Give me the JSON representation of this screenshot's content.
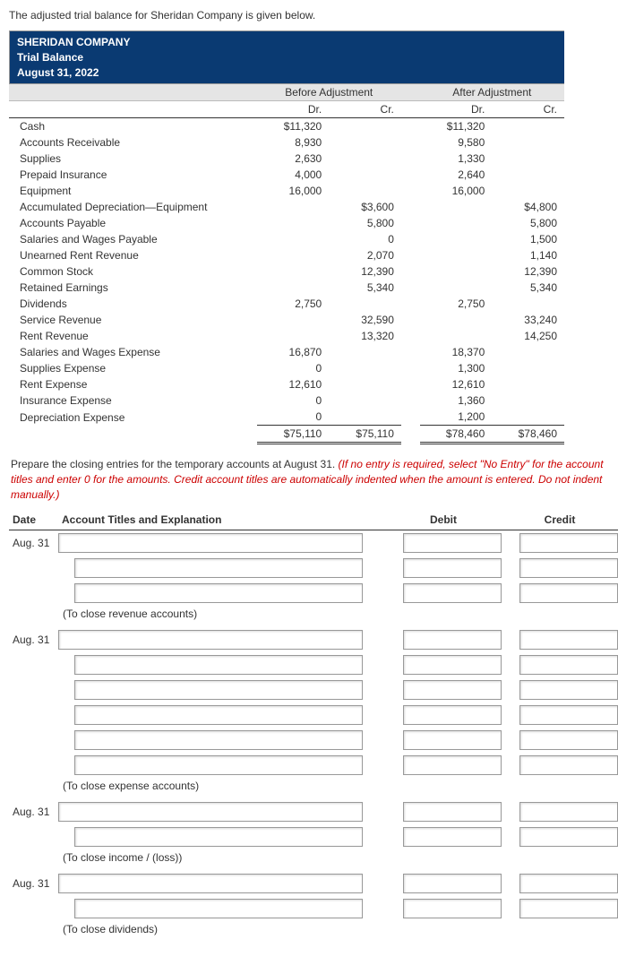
{
  "intro": "The adjusted trial balance for Sheridan Company is given below.",
  "company": "SHERIDAN COMPANY",
  "report": "Trial Balance",
  "asof": "August 31, 2022",
  "group_before": "Before Adjustment",
  "group_after": "After Adjustment",
  "col_dr": "Dr.",
  "col_cr": "Cr.",
  "rows": [
    {
      "a": "Cash",
      "bd": "$11,320",
      "bc": "",
      "ad": "$11,320",
      "ac": ""
    },
    {
      "a": "Accounts Receivable",
      "bd": "8,930",
      "bc": "",
      "ad": "9,580",
      "ac": ""
    },
    {
      "a": "Supplies",
      "bd": "2,630",
      "bc": "",
      "ad": "1,330",
      "ac": ""
    },
    {
      "a": "Prepaid Insurance",
      "bd": "4,000",
      "bc": "",
      "ad": "2,640",
      "ac": ""
    },
    {
      "a": "Equipment",
      "bd": "16,000",
      "bc": "",
      "ad": "16,000",
      "ac": ""
    },
    {
      "a": "Accumulated Depreciation—Equipment",
      "bd": "",
      "bc": "$3,600",
      "ad": "",
      "ac": "$4,800"
    },
    {
      "a": "Accounts Payable",
      "bd": "",
      "bc": "5,800",
      "ad": "",
      "ac": "5,800"
    },
    {
      "a": "Salaries and Wages Payable",
      "bd": "",
      "bc": "0",
      "ad": "",
      "ac": "1,500"
    },
    {
      "a": "Unearned Rent Revenue",
      "bd": "",
      "bc": "2,070",
      "ad": "",
      "ac": "1,140"
    },
    {
      "a": "Common Stock",
      "bd": "",
      "bc": "12,390",
      "ad": "",
      "ac": "12,390"
    },
    {
      "a": "Retained Earnings",
      "bd": "",
      "bc": "5,340",
      "ad": "",
      "ac": "5,340"
    },
    {
      "a": "Dividends",
      "bd": "2,750",
      "bc": "",
      "ad": "2,750",
      "ac": ""
    },
    {
      "a": "Service Revenue",
      "bd": "",
      "bc": "32,590",
      "ad": "",
      "ac": "33,240"
    },
    {
      "a": "Rent Revenue",
      "bd": "",
      "bc": "13,320",
      "ad": "",
      "ac": "14,250"
    },
    {
      "a": "Salaries and Wages Expense",
      "bd": "16,870",
      "bc": "",
      "ad": "18,370",
      "ac": ""
    },
    {
      "a": "Supplies Expense",
      "bd": "0",
      "bc": "",
      "ad": "1,300",
      "ac": ""
    },
    {
      "a": "Rent Expense",
      "bd": "12,610",
      "bc": "",
      "ad": "12,610",
      "ac": ""
    },
    {
      "a": "Insurance Expense",
      "bd": "0",
      "bc": "",
      "ad": "1,360",
      "ac": ""
    },
    {
      "a": "Depreciation Expense",
      "bd": "0",
      "bc": "",
      "ad": "1,200",
      "ac": ""
    }
  ],
  "totals": {
    "bd": "$75,110",
    "bc": "$75,110",
    "ad": "$78,460",
    "ac": "$78,460"
  },
  "instr_black": "Prepare the closing entries for the temporary accounts at August 31. ",
  "instr_red": "(If no entry is required, select \"No Entry\" for the account titles and enter 0 for the amounts. Credit account titles are automatically indented when the amount is entered. Do not indent manually.)",
  "je_headers": {
    "date": "Date",
    "acct": "Account Titles and Explanation",
    "dr": "Debit",
    "cr": "Credit"
  },
  "date_label": "Aug. 31",
  "notes": {
    "rev": "(To close revenue accounts)",
    "exp": "(To close expense accounts)",
    "inc": "(To close income / (loss))",
    "div": "(To close dividends)"
  }
}
